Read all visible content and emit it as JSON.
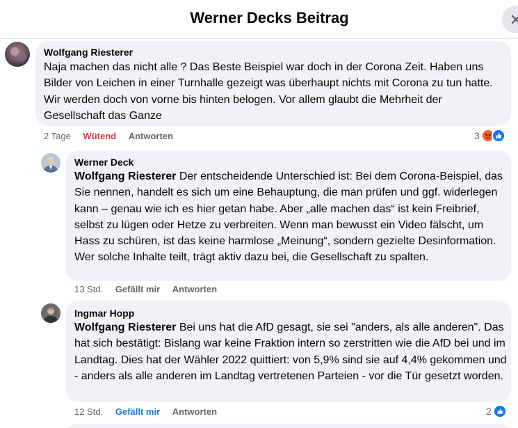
{
  "header": {
    "title": "Werner Decks Beitrag"
  },
  "comments": [
    {
      "author": "Wolfgang Riesterer",
      "text": "Naja machen das nicht alle ? Das Beste Beispiel war doch in der Corona Zeit. Haben uns Bilder von Leichen in einer Turnhalle gezeigt was überhaupt nichts mit Corona zu tun hatte. Wir werden doch von vorne bis hinten belogen. Vor allem glaubt die Mehrheit der Gesellschaft das Ganze",
      "time": "2 Tage",
      "reaction_label": "Wütend",
      "reply_label": "Antworten",
      "reaction_count": "3",
      "reaction_icons": [
        "angry-icon",
        "like-icon"
      ]
    },
    {
      "author": "Werner Deck",
      "mention": "Wolfgang Riesterer",
      "text": " Der entscheidende Unterschied ist: Bei dem Corona-Beispiel, das Sie nennen, handelt es sich um eine Behauptung, die man prüfen und ggf. widerlegen kann – genau wie ich es hier getan habe. Aber „alle machen das“ ist kein Freibrief, selbst zu lügen oder Hetze zu verbreiten. Wenn man bewusst ein Video fälscht, um Hass zu schüren, ist das keine harmlose „Meinung“, sondern gezielte Desinformation. Wer solche Inhalte teilt, trägt aktiv dazu bei, die Gesellschaft zu spalten.",
      "time": "13 Std.",
      "like_label": "Gefällt mir",
      "reply_label": "Antworten"
    },
    {
      "author": "Ingmar Hopp",
      "mention": "Wolfgang Riesterer",
      "text": " Bei uns hat die AfD gesagt, sie sei \"anders, als alle anderen\". Das hat sich bestätigt: Bislang war keine Fraktion intern so zerstritten wie die AfD bei und im Landtag. Dies hat der Wähler 2022 quittiert: von 5,9% sind sie auf 4,4% gekommen und - anders als alle anderen im Landtag vertretenen Parteien - vor die Tür gesetzt worden.",
      "time": "12 Std.",
      "like_label": "Gefällt mir",
      "reply_label": "Antworten",
      "reaction_count": "2",
      "reaction_icons": [
        "like-icon"
      ]
    }
  ],
  "colors": {
    "bubble": "#f0f2f5",
    "meta": "#65676b",
    "angry": "#e4384a",
    "like": "#1877f2"
  }
}
